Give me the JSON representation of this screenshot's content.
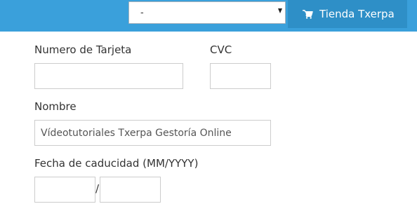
{
  "header": {
    "select": {
      "value": "-"
    },
    "shop_button": {
      "label": "Tienda Txerpa",
      "icon": "shopping-cart-icon"
    }
  },
  "form": {
    "card_number": {
      "label": "Numero de Tarjeta",
      "value": ""
    },
    "cvc": {
      "label": "CVC",
      "value": ""
    },
    "name": {
      "label": "Nombre",
      "value": "Vídeotutoriales Txerpa Gestoría Online"
    },
    "expiry": {
      "label": "Fecha de caducidad (MM/YYYY)",
      "separator": "/",
      "month_value": "",
      "year_value": ""
    }
  },
  "colors": {
    "topbar": "#3aa0db",
    "shop_button": "#2e8fc7",
    "field_border": "#cccccc"
  }
}
